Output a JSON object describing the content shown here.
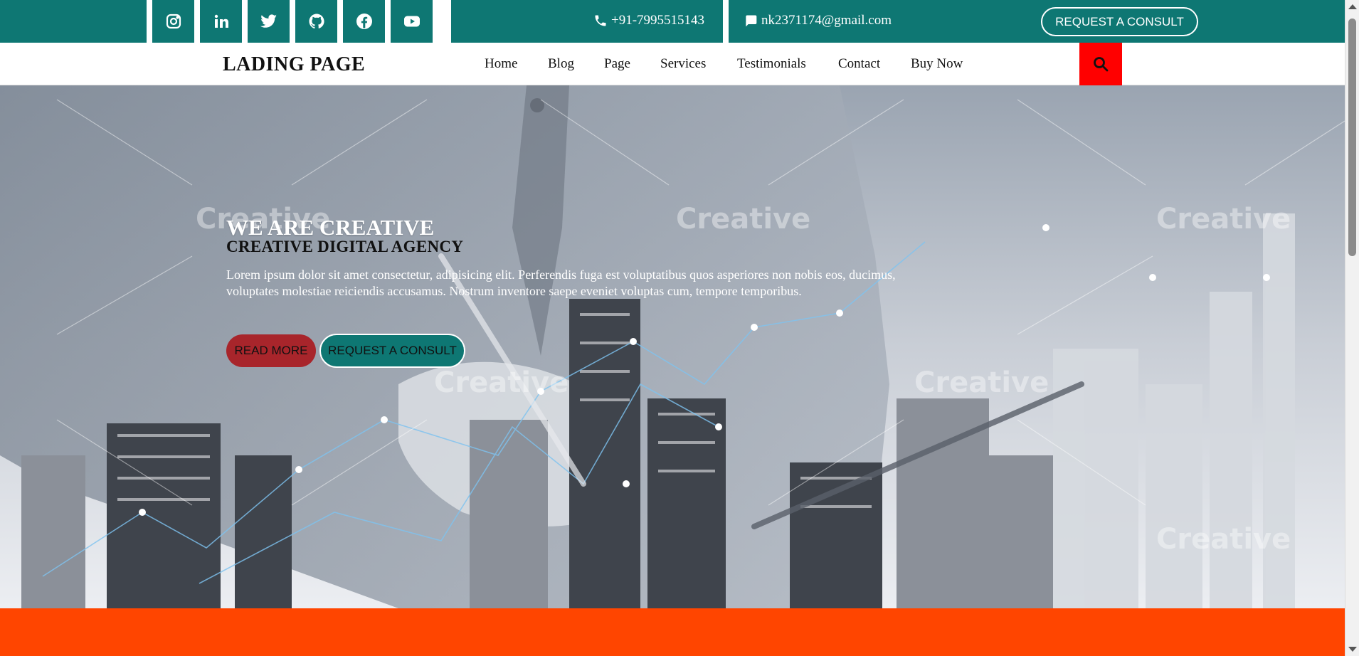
{
  "topbar": {
    "social_icons": [
      "instagram-icon",
      "linkedin-icon",
      "twitter-icon",
      "github-icon",
      "facebook-icon",
      "youtube-icon"
    ],
    "phone": "+91-7995515143",
    "email": "nk2371174@gmail.com",
    "consult_label": "REQUEST A CONSULT"
  },
  "nav": {
    "logo": "LADING PAGE",
    "items": [
      "Home",
      "Blog",
      "Page",
      "Services",
      "Testimonials",
      "Contact",
      "Buy Now"
    ]
  },
  "hero": {
    "title": "WE ARE CREATIVE",
    "subtitle": "CREATIVE DIGITAL AGENCY",
    "text": "Lorem ipsum dolor sit amet consectetur, adipisicing elit. Perferendis fuga est voluptatibus quos asperiores non nobis eos, ducimus, voluptates molestiae reiciendis accusamus. Nostrum inventore saepe eveniet voluptas cum, tempore temporibus.",
    "read_more_label": "READ MORE",
    "consult_label": "REQUEST A CONSULT",
    "watermark": "Creative"
  },
  "colors": {
    "teal": "#0e7773",
    "search_red": "#ff0000",
    "read_more_red": "#a8252b",
    "orange": "#ff4500"
  }
}
